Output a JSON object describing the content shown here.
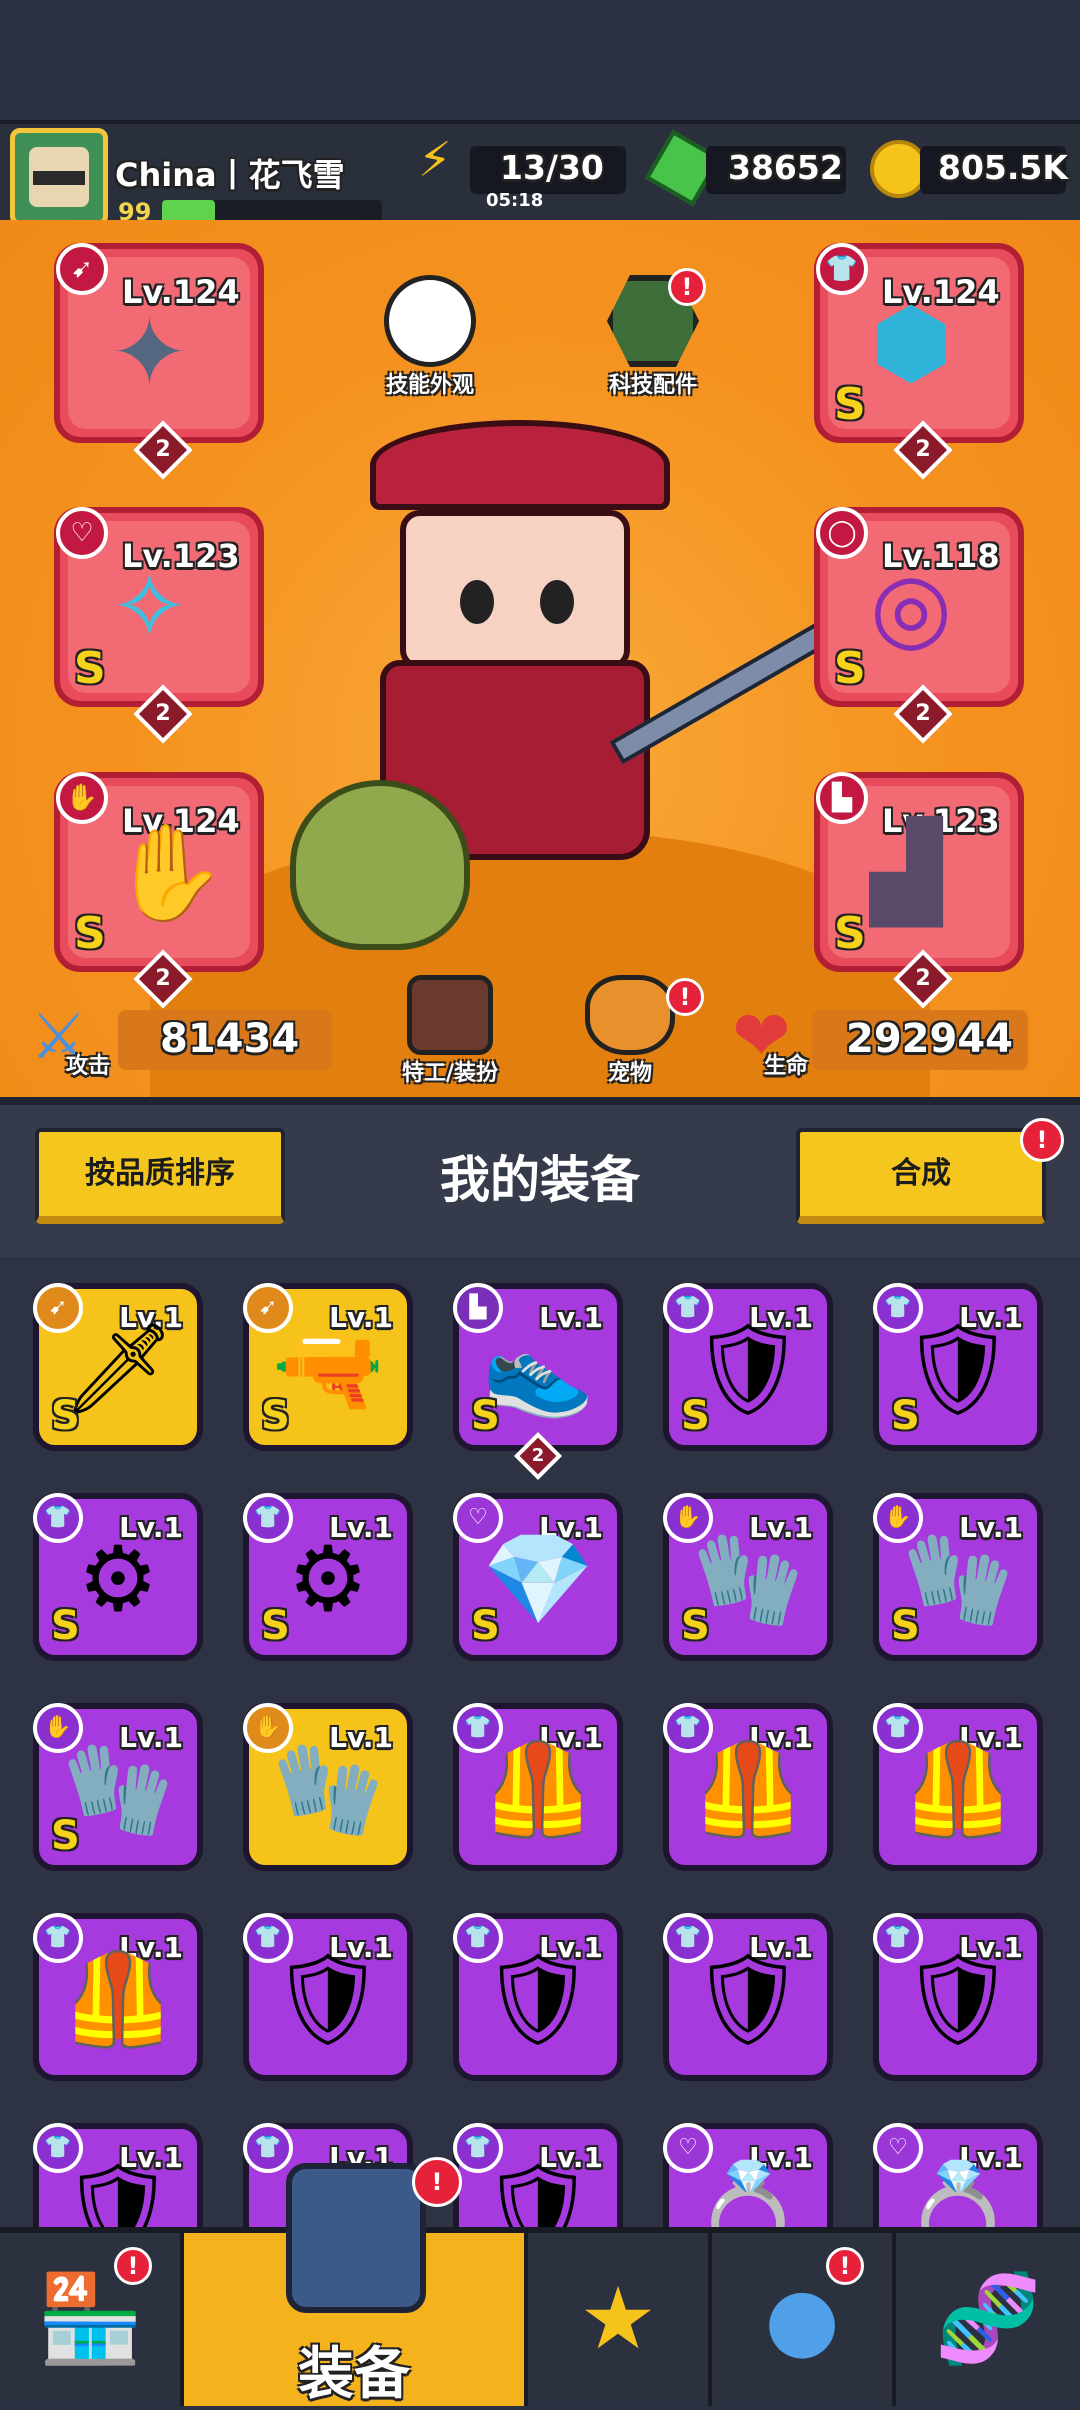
{
  "player": {
    "name": "China丨花飞雪",
    "level": "99",
    "xp_fraction": 0.24
  },
  "resources": {
    "energy": "13/30",
    "energy_timer": "05:18",
    "gems": "38652",
    "coins": "805.5K"
  },
  "hero": {
    "hub": {
      "skill_skin": "技能外观",
      "tech_parts": "科技配件",
      "agent": "特工/装扮",
      "pet": "宠物"
    },
    "attack_label": "攻击",
    "attack_value": "81434",
    "hp_label": "生命",
    "hp_value": "292944",
    "slots": [
      {
        "lv": "Lv.124",
        "stars": "2",
        "grade": "",
        "icon": "kunai-icon"
      },
      {
        "lv": "Lv.124",
        "stars": "2",
        "grade": "S",
        "icon": "armor-icon"
      },
      {
        "lv": "Lv.123",
        "stars": "2",
        "grade": "S",
        "icon": "necklace-icon"
      },
      {
        "lv": "Lv.118",
        "stars": "2",
        "grade": "S",
        "icon": "belt-icon"
      },
      {
        "lv": "Lv.124",
        "stars": "2",
        "grade": "S",
        "icon": "glove-icon"
      },
      {
        "lv": "Lv.123",
        "stars": "2",
        "grade": "S",
        "icon": "boots-icon"
      }
    ],
    "badge": "!"
  },
  "inventory": {
    "sort_button": "按品质排序",
    "title": "我的装备",
    "merge_button": "合成",
    "items": [
      {
        "lv": "Lv.1",
        "grade": "S",
        "color": "gold",
        "glyph": "🗡",
        "type": "weapon"
      },
      {
        "lv": "Lv.1",
        "grade": "S",
        "color": "gold",
        "glyph": "🔫",
        "type": "weapon"
      },
      {
        "lv": "Lv.1",
        "grade": "S",
        "color": "purple",
        "glyph": "👟",
        "type": "boots",
        "stars": "2"
      },
      {
        "lv": "Lv.1",
        "grade": "S",
        "color": "purple",
        "glyph": "🛡",
        "type": "armor"
      },
      {
        "lv": "Lv.1",
        "grade": "S",
        "color": "purple",
        "glyph": "🛡",
        "type": "armor"
      },
      {
        "lv": "Lv.1",
        "grade": "S",
        "color": "purple",
        "glyph": "⚙",
        "type": "armor"
      },
      {
        "lv": "Lv.1",
        "grade": "S",
        "color": "purple",
        "glyph": "⚙",
        "type": "armor"
      },
      {
        "lv": "Lv.1",
        "grade": "S",
        "color": "purple",
        "glyph": "💎",
        "type": "necklace"
      },
      {
        "lv": "Lv.1",
        "grade": "S",
        "color": "purple",
        "glyph": "🧤",
        "type": "glove"
      },
      {
        "lv": "Lv.1",
        "grade": "S",
        "color": "purple",
        "glyph": "🧤",
        "type": "glove"
      },
      {
        "lv": "Lv.1",
        "grade": "S",
        "color": "purple",
        "glyph": "🧤",
        "type": "glove"
      },
      {
        "lv": "Lv.1",
        "grade": "",
        "color": "gold",
        "glyph": "🧤",
        "type": "glove"
      },
      {
        "lv": "Lv.1",
        "grade": "",
        "color": "purple",
        "glyph": "🦺",
        "type": "armor"
      },
      {
        "lv": "Lv.1",
        "grade": "",
        "color": "purple",
        "glyph": "🦺",
        "type": "armor"
      },
      {
        "lv": "Lv.1",
        "grade": "",
        "color": "purple",
        "glyph": "🦺",
        "type": "armor"
      },
      {
        "lv": "Lv.1",
        "grade": "",
        "color": "purple",
        "glyph": "🦺",
        "type": "armor"
      },
      {
        "lv": "Lv.1",
        "grade": "",
        "color": "purple",
        "glyph": "🛡",
        "type": "armor"
      },
      {
        "lv": "Lv.1",
        "grade": "",
        "color": "purple",
        "glyph": "🛡",
        "type": "armor"
      },
      {
        "lv": "Lv.1",
        "grade": "",
        "color": "purple",
        "glyph": "🛡",
        "type": "armor"
      },
      {
        "lv": "Lv.1",
        "grade": "",
        "color": "purple",
        "glyph": "🛡",
        "type": "armor"
      },
      {
        "lv": "Lv.1",
        "grade": "",
        "color": "purple",
        "glyph": "🛡",
        "type": "armor"
      },
      {
        "lv": "Lv.1",
        "grade": "",
        "color": "purple",
        "glyph": "🛡",
        "type": "armor"
      },
      {
        "lv": "Lv.1",
        "grade": "",
        "color": "purple",
        "glyph": "🛡",
        "type": "armor"
      },
      {
        "lv": "Lv.1",
        "grade": "",
        "color": "purple",
        "glyph": "💍",
        "type": "necklace"
      },
      {
        "lv": "Lv.1",
        "grade": "",
        "color": "purple",
        "glyph": "💍",
        "type": "necklace"
      }
    ]
  },
  "nav": {
    "items": [
      {
        "name": "shop",
        "icon": "shop-icon",
        "badge": "!"
      },
      {
        "name": "equipment",
        "label": "装备",
        "icon": "equipment-icon",
        "badge": "!"
      },
      {
        "name": "battle",
        "icon": "battle-star-icon"
      },
      {
        "name": "gacha",
        "icon": "egg-icon",
        "badge": "!"
      },
      {
        "name": "dna",
        "icon": "dna-icon"
      }
    ]
  },
  "colors": {
    "hero_bg": "#f5921f",
    "slot_red": "#e84b5b",
    "purple": "#a63adf",
    "gold": "#f6c31a",
    "accent_yellow": "#f5c61e"
  }
}
